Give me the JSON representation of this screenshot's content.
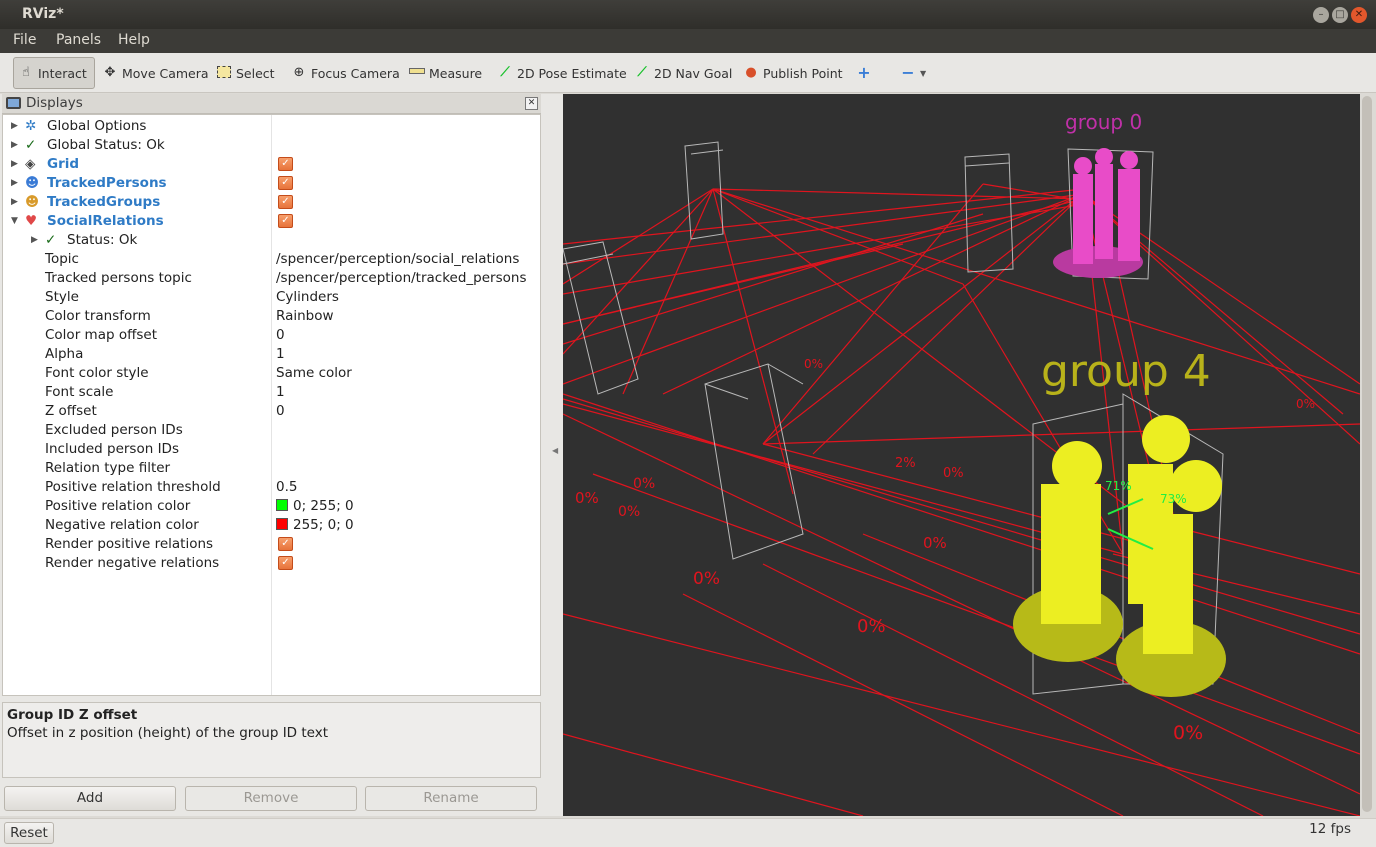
{
  "window": {
    "title": "RViz*"
  },
  "menu": [
    "File",
    "Panels",
    "Help"
  ],
  "toolbar": {
    "interact": "Interact",
    "move_camera": "Move Camera",
    "select": "Select",
    "focus_camera": "Focus Camera",
    "measure": "Measure",
    "pose_estimate": "2D Pose Estimate",
    "nav_goal": "2D Nav Goal",
    "publish_point": "Publish Point"
  },
  "displays": {
    "title": "Displays",
    "items": [
      {
        "label": "Global Options"
      },
      {
        "label": "Global Status: Ok"
      },
      {
        "label": "Grid"
      },
      {
        "label": "TrackedPersons"
      },
      {
        "label": "TrackedGroups"
      },
      {
        "label": "SocialRelations"
      },
      {
        "label": "Status: Ok"
      }
    ],
    "props": [
      {
        "name": "Topic",
        "value": "/spencer/perception/social_relations"
      },
      {
        "name": "Tracked persons topic",
        "value": "/spencer/perception/tracked_persons"
      },
      {
        "name": "Style",
        "value": "Cylinders"
      },
      {
        "name": "Color transform",
        "value": "Rainbow"
      },
      {
        "name": "Color map offset",
        "value": "0"
      },
      {
        "name": "Alpha",
        "value": "1"
      },
      {
        "name": "Font color style",
        "value": "Same color"
      },
      {
        "name": "Font scale",
        "value": "1"
      },
      {
        "name": "Z offset",
        "value": "0"
      },
      {
        "name": "Excluded person IDs",
        "value": ""
      },
      {
        "name": "Included person IDs",
        "value": ""
      },
      {
        "name": "Relation type filter",
        "value": ""
      },
      {
        "name": "Positive relation threshold",
        "value": "0.5"
      },
      {
        "name": "Positive relation color",
        "value": "0; 255; 0"
      },
      {
        "name": "Negative relation color",
        "value": "255; 0; 0"
      },
      {
        "name": "Render positive relations",
        "value": ""
      },
      {
        "name": "Render negative relations",
        "value": ""
      }
    ],
    "positive_color": "#00ff00",
    "negative_color": "#ff0000"
  },
  "description": {
    "title": "Group ID Z offset",
    "body": "Offset in z position (height) of the group ID text"
  },
  "buttons": {
    "add": "Add",
    "remove": "Remove",
    "rename": "Rename"
  },
  "status": {
    "reset": "Reset",
    "fps": "12 fps"
  },
  "viewport": {
    "labels": {
      "group0": "group 0",
      "group4": "group 4"
    },
    "percent_labels": [
      "0%",
      "71%",
      "73%",
      "2%"
    ],
    "colors": {
      "background": "#303030",
      "relation": "#e0141e",
      "group0": "#e84cc8",
      "group4": "#ecee22",
      "positive": "#22ee44"
    }
  }
}
